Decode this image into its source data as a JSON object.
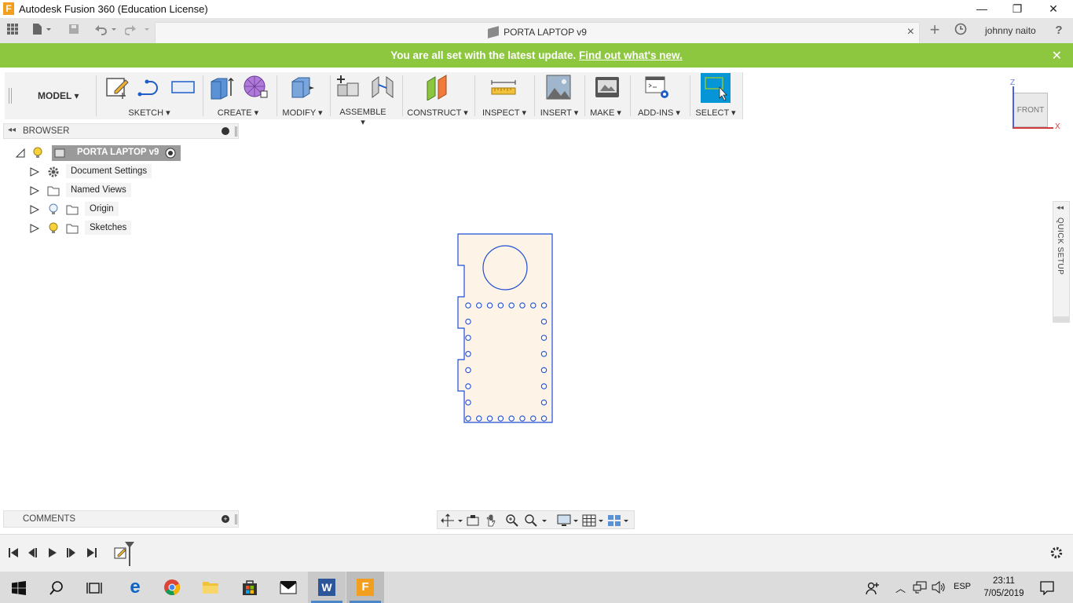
{
  "window": {
    "title": "Autodesk Fusion 360 (Education License)",
    "app_icon_letter": "F",
    "controls": {
      "minimize": "—",
      "restore": "❐",
      "close": "✕"
    }
  },
  "tabbar": {
    "document_title": "PORTA LAPTOP v9",
    "user": "johnny naito",
    "help": "?"
  },
  "banner": {
    "message": "You are all set with the latest update.",
    "link": "Find out what's new."
  },
  "toolbar": {
    "workspace": "MODEL",
    "groups": [
      "SKETCH",
      "CREATE",
      "MODIFY",
      "ASSEMBLE",
      "CONSTRUCT",
      "INSPECT",
      "INSERT",
      "MAKE",
      "ADD-INS",
      "SELECT"
    ]
  },
  "viewcube": {
    "face": "FRONT",
    "axis_z": "Z",
    "axis_x": "X"
  },
  "browser": {
    "header": "BROWSER",
    "root": "PORTA LAPTOP v9",
    "items": [
      {
        "label": "Document Settings"
      },
      {
        "label": "Named Views"
      },
      {
        "label": "Origin"
      },
      {
        "label": "Sketches"
      }
    ]
  },
  "comments": {
    "header": "COMMENTS"
  },
  "quick_setup": {
    "label": "QUICK SETUP"
  },
  "taskbar": {
    "language": "ESP",
    "time": "23:11",
    "date": "7/05/2019"
  },
  "colors": {
    "banner": "#8dc63f",
    "select_active": "#0696d7",
    "sketch_line": "#1f4fd6",
    "sketch_fill": "#fdf3e7",
    "app_orange": "#f29e1f"
  }
}
